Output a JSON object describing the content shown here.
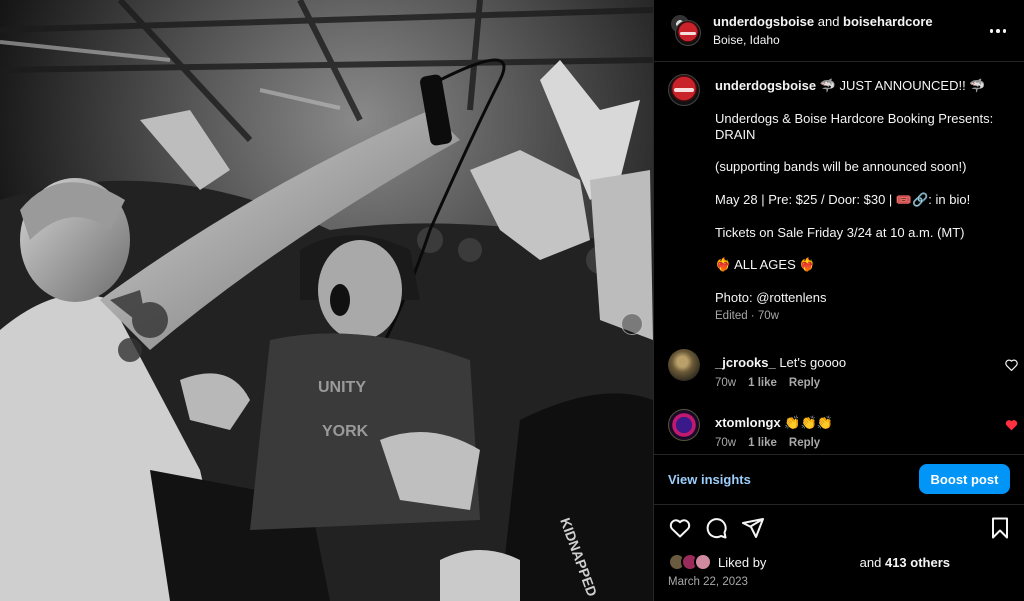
{
  "post": {
    "header": {
      "primary_user": "underdogsboise",
      "and_text": " and ",
      "collab_user": "boisehardcore",
      "location": "Boise, Idaho",
      "more_icon": "more-horizontal-icon"
    },
    "caption": {
      "username": "underdogsboise",
      "line1_rest": " 🦈 JUST ANNOUNCED!! 🦈",
      "lines": [
        "",
        "Underdogs & Boise Hardcore Booking Presents:",
        "DRAIN",
        "",
        "(supporting bands will be announced soon!)",
        "",
        "May 28 | Pre: $25 / Door: $30 | 🎟️🔗: in bio!",
        "",
        "Tickets on Sale Friday 3/24 at 10 a.m. (MT)",
        "",
        "❤️‍🔥 ALL AGES ❤️‍🔥",
        "",
        "Photo: @rottenlens"
      ],
      "edited_label": "Edited · 70w"
    },
    "comments": [
      {
        "username": "_jcrooks_",
        "text": "Let's goooo",
        "age": "70w",
        "likes": "1 like",
        "reply": "Reply",
        "liked": false
      },
      {
        "username": "xtomlongx",
        "text": "👏👏👏",
        "age": "70w",
        "likes": "1 like",
        "reply": "Reply",
        "liked": true
      }
    ],
    "insights": {
      "view_label": "View insights",
      "boost_label": "Boost post"
    },
    "actions": [
      "heart-icon",
      "comment-icon",
      "share-icon",
      "bookmark-icon"
    ],
    "likes": {
      "prefix": "Liked by ",
      "suffix_and": " and ",
      "count": "413 others"
    },
    "date": "March 22, 2023"
  },
  "colors": {
    "background": "#000000",
    "text": "#f5f5f5",
    "muted": "#a8a8a8",
    "accent_blue": "#0095f6",
    "link_blue": "#9ccdfb",
    "liked_red": "#ff3040",
    "divider": "#262626"
  }
}
